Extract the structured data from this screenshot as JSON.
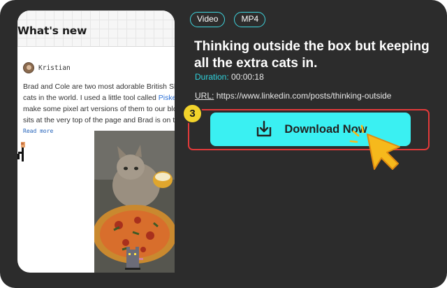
{
  "preview": {
    "title": "What's new",
    "author": "Kristian",
    "body_before_link": "Brad and Cole are two most adorable British Shorthair cats in the world. I used a little tool called ",
    "link": "Piskel",
    "body_after_link": " to make some pixel art versions of them to our blog. Cole sits at the very top of the page and Brad is on the...",
    "read_more": "Read more"
  },
  "tags": [
    "Video",
    "MP4"
  ],
  "video": {
    "title": "Thinking outside the box but keeping all the extra cats in.",
    "duration_label": "Duration:",
    "duration_value": "00:00:18",
    "url_label": "URL:",
    "url_value": "https://www.linkedin.com/posts/thinking-outside"
  },
  "step_number": "3",
  "download_button": {
    "label": "Download Now",
    "icon": "download-icon"
  },
  "colors": {
    "background": "#2c2c2c",
    "accent_cyan": "#3af0f2",
    "tag_border": "#3fd6df",
    "highlight_red": "#e23a3a",
    "badge_yellow": "#f2d32b",
    "cursor_yellow": "#f6b91c"
  }
}
